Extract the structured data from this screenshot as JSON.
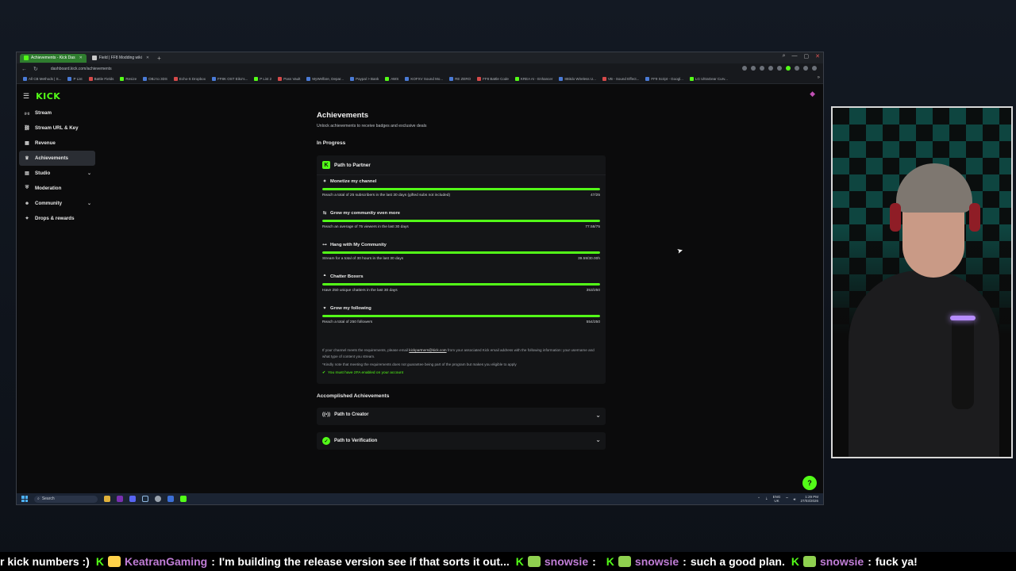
{
  "browser": {
    "tabs": [
      {
        "label": "Achievements - Kick Das",
        "active": true
      },
      {
        "label": "Field | FF8 Modding wiki",
        "active": false
      }
    ],
    "url": "dashboard.kick.com/achievements",
    "bookmarks": [
      "All CB Methods | S...",
      "P List",
      "Battle Fields",
      "Resize",
      "OBJ to 3DS",
      "Echo-S Dropbox",
      "FF8K OST Eiko's...",
      "P List 2",
      "Pass Vault",
      "MyWelfare, Depar...",
      "Paypal > Bank",
      "AWS",
      "KOFXV Sound Mo...",
      "RE ZERO",
      "FF8 Battle Code",
      "KREA AI - Enhancer",
      "8Bitdo Wireless U...",
      "VB - Sound Effect...",
      "FF9 Script - Googl...",
      "LG UltraGear Curv..."
    ]
  },
  "brand": {
    "logo": "KICK",
    "accent": "#53fc18"
  },
  "sidebar": {
    "items": [
      {
        "label": "Stream",
        "icon": "broadcast-icon"
      },
      {
        "label": "Stream URL & Key",
        "icon": "link-icon"
      },
      {
        "label": "Revenue",
        "icon": "dollar-icon"
      },
      {
        "label": "Achievements",
        "icon": "trophy-icon",
        "active": true
      },
      {
        "label": "Studio",
        "icon": "studio-icon",
        "expandable": true
      },
      {
        "label": "Moderation",
        "icon": "shield-icon"
      },
      {
        "label": "Community",
        "icon": "community-icon",
        "expandable": true
      },
      {
        "label": "Drops & rewards",
        "icon": "gift-icon"
      }
    ]
  },
  "page": {
    "title": "Achievements",
    "subtitle": "Unlock achievements to receive badges and exclusive deals",
    "in_progress_heading": "In Progress",
    "accomplished_heading": "Accomplished Achievements"
  },
  "partner": {
    "title": "Path to Partner",
    "tasks": [
      {
        "title": "Monetize my channel",
        "desc": "Reach a total of 25 subscribers in the last 30 days (gifted subs not included)",
        "value": "47/25",
        "progress": 1.0
      },
      {
        "title": "Grow my community even more",
        "desc": "Reach an average of 75 viewers in the last 30 days",
        "value": "77.58/75",
        "progress": 1.0
      },
      {
        "title": "Hang with My Community",
        "desc": "Stream for a total of 30 hours in the last 30 days",
        "value": "39.59/30.00h",
        "progress": 1.0
      },
      {
        "title": "Chatter Boxers",
        "desc": "Have 250 unique chatters in the last 30 days",
        "value": "353/250",
        "progress": 1.0
      },
      {
        "title": "Grow my following",
        "desc": "Reach a total of 250 followers",
        "value": "554/250",
        "progress": 1.0
      }
    ],
    "note_prefix": "If your channel meets the requirements, please email",
    "note_email": "kickpartners@kick.com",
    "note_suffix": "from your associated Kick email address with the following information: your username and what type of content you stream.",
    "note2": "*Kindly note that meeting the requirements does not guarantee being part of the program but makes you eligible to apply",
    "twofa": "You must have 2FA enabled on your account"
  },
  "accomplished": [
    {
      "title": "Path to Creator"
    },
    {
      "title": "Path to Verification"
    }
  ],
  "taskbar": {
    "search": "Search",
    "lang_top": "ENG",
    "lang_bottom": "UK",
    "time": "1:29 PM",
    "date": "27/03/2026"
  },
  "ticker": {
    "lead": "r kick numbers :)",
    "messages": [
      {
        "user": "KeatranGaming",
        "text": "I'm building the release version see if that sorts it out..."
      },
      {
        "user": "snowsie",
        "text": ""
      },
      {
        "user": "snowsie",
        "text": "such a good plan."
      },
      {
        "user": "snowsie",
        "text": "fuck ya!"
      }
    ]
  }
}
